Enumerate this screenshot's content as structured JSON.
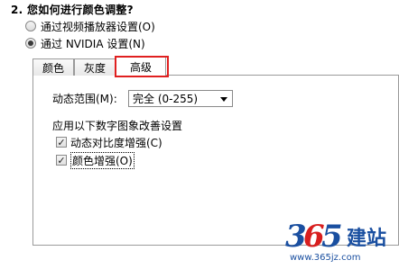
{
  "section": {
    "heading": "2. 您如何进行颜色调整?",
    "options": [
      {
        "label": "通过视频播放器设置(O)",
        "checked": false
      },
      {
        "label": "通过 NVIDIA 设置(N)",
        "checked": true
      }
    ]
  },
  "tabs": [
    {
      "label": "颜色",
      "active": false
    },
    {
      "label": "灰度",
      "active": false
    },
    {
      "label": "高级",
      "active": true
    }
  ],
  "advanced": {
    "dynamic_range_label": "动态范围(M):",
    "dynamic_range_value": "完全 (0-255)",
    "apply_label": "应用以下数字图象改善设置",
    "checkboxes": [
      {
        "label": "动态对比度增强(C)",
        "checked": true
      },
      {
        "label": "颜色增强(O)",
        "checked": true
      }
    ]
  },
  "watermark": {
    "logo": "365建站",
    "url": "www.365jz.com"
  },
  "colors": {
    "highlight": "#e02020",
    "watermark_blue": "#1a4fa0",
    "watermark_red": "#d81e1e"
  }
}
